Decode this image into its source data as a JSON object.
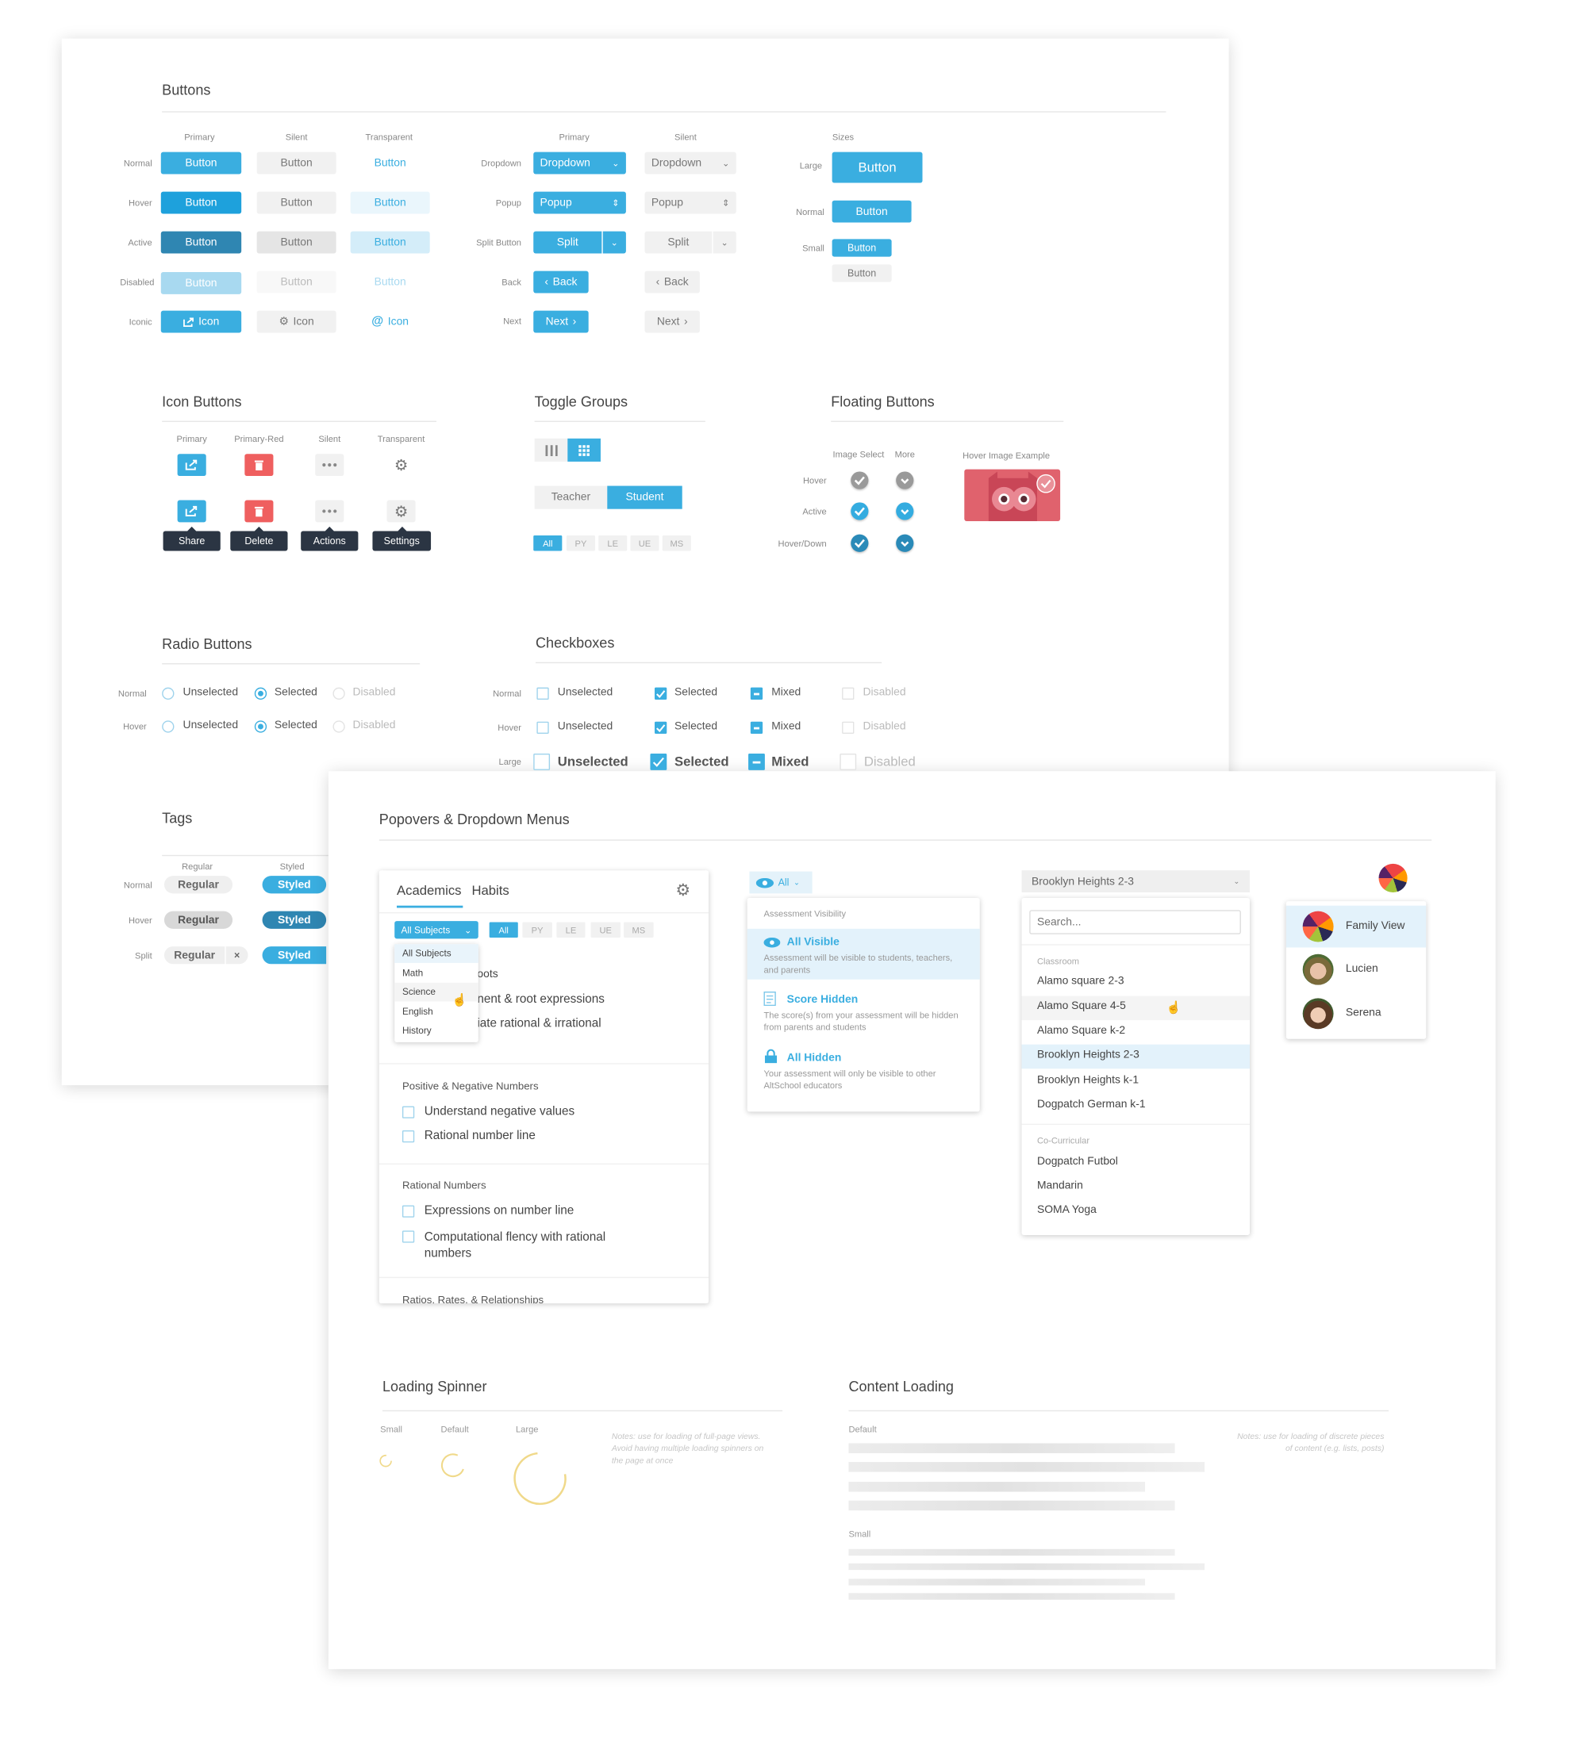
{
  "buttons": {
    "title": "Buttons",
    "columns": {
      "primary": "Primary",
      "silent": "Silent",
      "transparent": "Transparent",
      "menu_primary": "Primary",
      "menu_silent": "Silent",
      "sizes": "Sizes"
    },
    "rows": {
      "normal": "Normal",
      "hover": "Hover",
      "active": "Active",
      "disabled": "Disabled",
      "iconic": "Iconic"
    },
    "button_label": "Button",
    "icon_label": "Icon",
    "menu_rows": {
      "dropdown": "Dropdown",
      "popup": "Popup",
      "split": "Split Button",
      "back": "Back",
      "next": "Next"
    },
    "dropdown_label": "Dropdown",
    "popup_label": "Popup",
    "split_label": "Split",
    "back_label": "Back",
    "next_label": "Next",
    "sizes": {
      "large": "Large",
      "normal": "Normal",
      "small": "Small"
    }
  },
  "icon_buttons": {
    "title": "Icon Buttons",
    "columns": [
      "Primary",
      "Primary-Red",
      "Silent",
      "Transparent"
    ],
    "icons": [
      "share-icon",
      "trash-icon",
      "more-dots-icon",
      "gear-icon"
    ],
    "tooltips": [
      "Share",
      "Delete",
      "Actions",
      "Settings"
    ]
  },
  "toggle_groups": {
    "title": "Toggle Groups",
    "view_icons": [
      "list-columns-icon",
      "grid-icon"
    ],
    "roles": [
      "Teacher",
      "Student"
    ],
    "role_selected": "Student",
    "levels": [
      "All",
      "PY",
      "LE",
      "UE",
      "MS"
    ],
    "level_selected": "All"
  },
  "floating_buttons": {
    "title": "Floating Buttons",
    "columns": [
      "Image Select",
      "More"
    ],
    "rows": [
      "Hover",
      "Active",
      "Hover/Down"
    ],
    "hover_image_label": "Hover Image Example"
  },
  "radio_buttons": {
    "title": "Radio Buttons",
    "rows": [
      "Normal",
      "Hover"
    ],
    "options": [
      "Unselected",
      "Selected",
      "Disabled"
    ]
  },
  "checkboxes": {
    "title": "Checkboxes",
    "rows": [
      "Normal",
      "Hover",
      "Large"
    ],
    "options": [
      "Unselected",
      "Selected",
      "Mixed",
      "Disabled"
    ]
  },
  "tags": {
    "title": "Tags",
    "columns": [
      "Regular",
      "Styled"
    ],
    "rows": [
      "Normal",
      "Hover",
      "Split"
    ],
    "regular_label": "Regular",
    "styled_label": "Styled",
    "remove_glyph": "×"
  },
  "popovers": {
    "title": "Popovers & Dropdown Menus",
    "academics": {
      "tabs": [
        "Academics",
        "Habits"
      ],
      "active_tab": "Academics",
      "subject_select": "All Subjects",
      "subject_options": [
        "All Subjects",
        "Math",
        "Science",
        "English",
        "History"
      ],
      "levels": [
        "All",
        "PY",
        "LE",
        "UE",
        "MS"
      ],
      "obscured_lines": [
        "oots",
        "nent & root expressions",
        "iate rational & irrational"
      ],
      "sections": [
        {
          "heading": "Positive & Negative Numbers",
          "items": [
            "Understand negative values",
            "Rational number line"
          ]
        },
        {
          "heading": "Rational Numbers",
          "items": [
            "Expressions on number line",
            "Computational flency with rational numbers"
          ]
        },
        {
          "heading": "Ratios, Rates, & Relationships",
          "items": []
        }
      ]
    },
    "visibility": {
      "trigger_label": "All",
      "heading": "Assessment Visibility",
      "options": [
        {
          "icon": "eye-icon",
          "title": "All Visible",
          "desc": "Assessment will be visible to students, teachers, and parents"
        },
        {
          "icon": "document-icon",
          "title": "Score Hidden",
          "desc": "The score(s) from your assessment will be hidden from parents and students"
        },
        {
          "icon": "lock-icon",
          "title": "All Hidden",
          "desc": "Your assessment will only be visible to other AltSchool educators"
        }
      ]
    },
    "classroom_select": {
      "value": "Brooklyn Heights 2-3",
      "search_placeholder": "Search...",
      "groups": [
        {
          "label": "Classroom",
          "items": [
            "Alamo square 2-3",
            "Alamo Square 4-5",
            "Alamo Square k-2",
            "Brooklyn Heights 2-3",
            "Brooklyn Heights k-1",
            "Dogpatch German k-1"
          ]
        },
        {
          "label": "Co-Curricular",
          "items": [
            "Dogpatch Futbol",
            "Mandarin",
            "SOMA Yoga"
          ]
        }
      ],
      "selected": "Brooklyn Heights 2-3",
      "hovered": "Alamo Square 4-5"
    },
    "profile_menu": {
      "items": [
        "Family View",
        "Lucien",
        "Serena"
      ],
      "selected": "Family View"
    }
  },
  "loading_spinner": {
    "title": "Loading Spinner",
    "sizes": [
      "Small",
      "Default",
      "Large"
    ],
    "note": "Notes: use for loading of full-page views. Avoid having multiple loading spinners on the page at once",
    "color": "#f0d98a"
  },
  "content_loading": {
    "title": "Content Loading",
    "sizes": [
      "Default",
      "Small"
    ],
    "note": "Notes: use for loading of discrete pieces of content (e.g. lists, posts)"
  },
  "colors": {
    "primary": "#3aaee0",
    "primary_red": "#ef5f5f",
    "tooltip": "#2b3543",
    "selected_row": "#e3f2fb"
  }
}
